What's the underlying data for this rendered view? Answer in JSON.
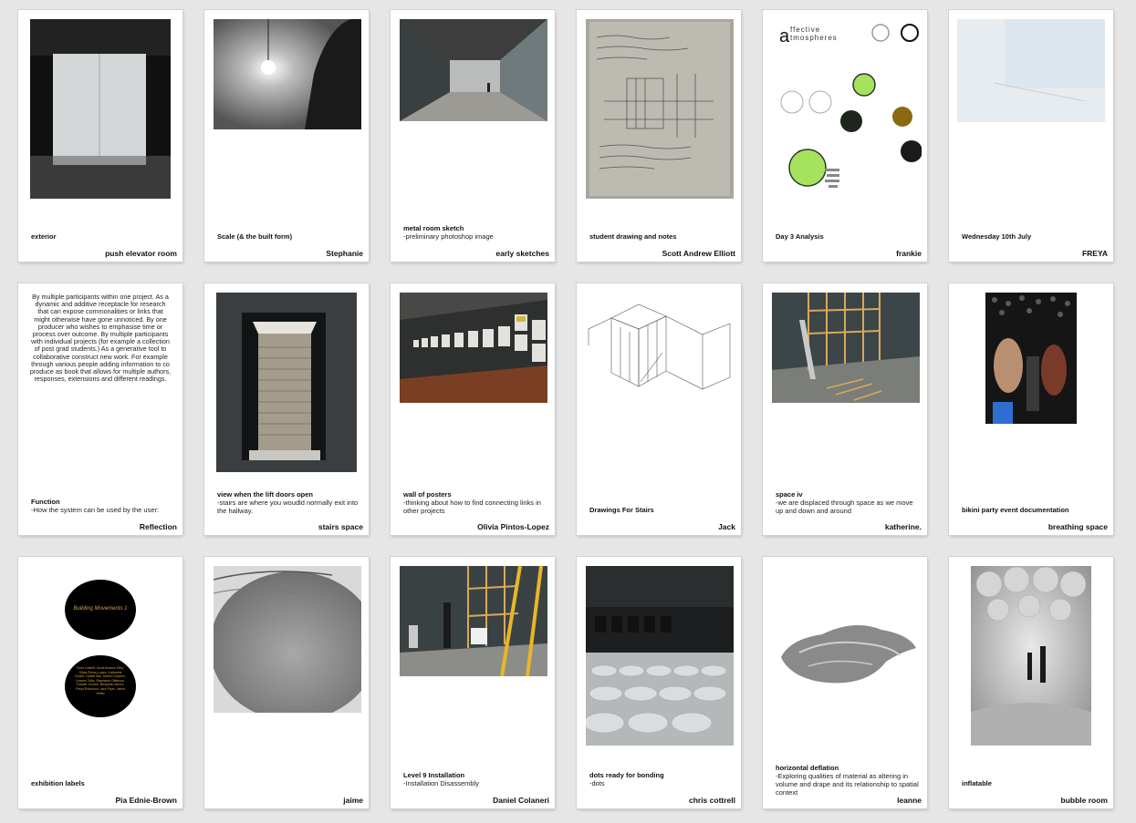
{
  "cards": [
    {
      "title": "exterior",
      "desc": "",
      "author": "push elevator room"
    },
    {
      "title": "Scale (& the built form)",
      "desc": "",
      "author": "Stephanie"
    },
    {
      "title": "metal room sketch",
      "desc": "-preliminary photoshop image",
      "author": "early sketches"
    },
    {
      "title": "student drawing and notes",
      "desc": "",
      "author": "Scott Andrew Elliott"
    },
    {
      "title": "Day 3 Analysis",
      "desc": "",
      "author": "frankie",
      "logo_text": "ffective\ntmospheres"
    },
    {
      "title": "Wednesday 10th July",
      "desc": "",
      "author": "FREYA"
    },
    {
      "title": "Function",
      "desc": "-How the system can be used by the user:",
      "author": "Reflection",
      "body": "By multiple participants within one project. As a dynamic and additive receptacle for research that can expose commonalities or links that might otherwise have gone unnoticed. By one producer who wishes to emphasise time or process over outcome. By multiple participants with individual projects (for example a collection of post grad students.) As a generative tool to collaborative construct new work. For example through various people adding information to co produce as book that allows for multiple authors, responses, extensions and different readings."
    },
    {
      "title": "view when the lift doors open",
      "desc": "-stairs are where you woudld normally exit into the hallway.",
      "author": "stairs space"
    },
    {
      "title": "wall of posters",
      "desc": "-thinking about how to find connecting links in other projects",
      "author": "Olivia Pintos-Lopez"
    },
    {
      "title": "Drawings For Stairs",
      "desc": "",
      "author": "Jack"
    },
    {
      "title": "space iv",
      "desc": "-we are displaced through space as we move up and down and around",
      "author": "katherine."
    },
    {
      "title": "bikini party event documentation",
      "desc": "",
      "author": "breathing space"
    },
    {
      "title": "exhibition labels",
      "desc": "",
      "author": "Pia Ednie-Brown",
      "label_top": "Building Movements 1",
      "label_bottom": "Chris Cottrell, Scott Andrew Elliot, Olivia Pintos-Lopez, Katherine Brown, Daniel Mui, Daniel Colaneri, Leanne Tsilis, Stephanie Gittleson, Frankie Gordon, Benjamin Moore, Freya Robinson, Jack Piper, Jamie Heffer"
    },
    {
      "title": "",
      "desc": "",
      "author": "jaime"
    },
    {
      "title": "Level 9 Installation",
      "desc": "-Installation Disassembly",
      "author": "Daniel Colaneri"
    },
    {
      "title": "dots ready for bonding",
      "desc": "-dots",
      "author": "chris cottrell"
    },
    {
      "title": "horizontal deflation",
      "desc": "-Exploring qualities of material as altering in volume and drape and its relationship to spatial context",
      "author": "leanne"
    },
    {
      "title": "inflatable",
      "desc": "",
      "author": "bubble room"
    }
  ]
}
